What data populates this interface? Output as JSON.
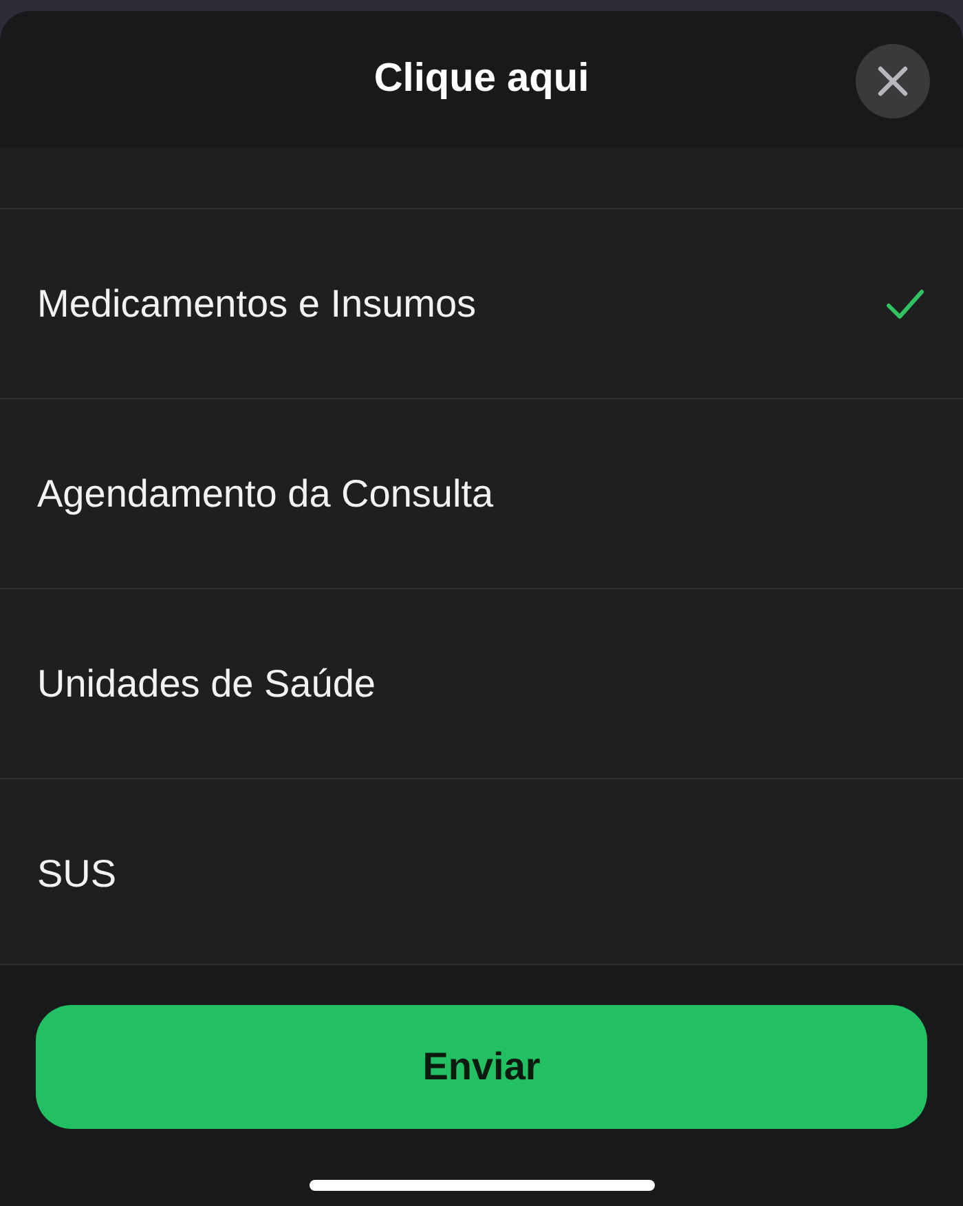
{
  "sheet": {
    "title": "Clique aqui"
  },
  "options": [
    {
      "label": "Medicamentos e Insumos",
      "selected": true
    },
    {
      "label": "Agendamento da Consulta",
      "selected": false
    },
    {
      "label": "Unidades de Saúde",
      "selected": false
    },
    {
      "label": "SUS",
      "selected": false
    }
  ],
  "submit_button": "Enviar"
}
